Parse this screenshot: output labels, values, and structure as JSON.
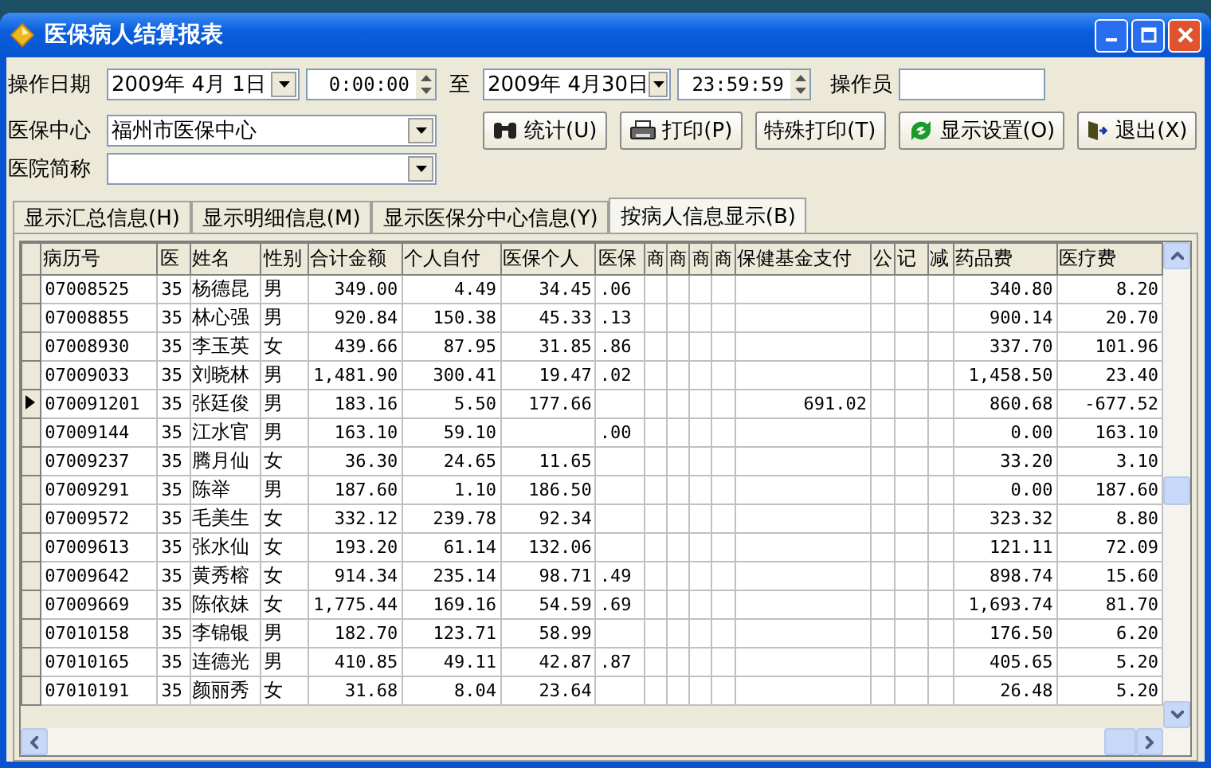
{
  "window": {
    "title": "医保病人结算报表"
  },
  "filters": {
    "date_label": "操作日期",
    "start_date": "2009年 4月 1日",
    "start_time": "0:00:00",
    "to_label": "至",
    "end_date": "2009年 4月30日",
    "end_time": "23:59:59",
    "operator_label": "操作员",
    "center_label": "医保中心",
    "center_value": "福州市医保中心",
    "hospital_label": "医院简称"
  },
  "buttons": [
    {
      "label": "统计(U)",
      "kind": "binoculars"
    },
    {
      "label": "打印(P)",
      "kind": "printer"
    },
    {
      "label": "特殊打印(T)",
      "kind": "plain"
    },
    {
      "label": "显示设置(O)",
      "kind": "refresh"
    },
    {
      "label": "退出(X)",
      "kind": "exit"
    }
  ],
  "tabs": [
    {
      "label": "显示汇总信息(H)",
      "selected": false
    },
    {
      "label": "显示明细信息(M)",
      "selected": false
    },
    {
      "label": "显示医保分中心信息(Y)",
      "selected": false
    },
    {
      "label": "按病人信息显示(B)",
      "selected": true
    }
  ],
  "table": {
    "columns": [
      "病历号",
      "医",
      "姓名",
      "性别",
      "合计金额",
      "个人自付",
      "医保个人",
      "医保",
      "商",
      "商",
      "商",
      "商",
      "保健基金支付",
      "公",
      "记",
      "减",
      "药品费",
      "医疗费"
    ],
    "rows": [
      {
        "selected": false,
        "cells": [
          "07008525",
          "35",
          "杨德昆",
          "男",
          "349.00",
          "4.49",
          "34.45",
          ".06",
          null,
          null,
          null,
          null,
          null,
          null,
          null,
          null,
          "340.80",
          "8.20"
        ]
      },
      {
        "selected": false,
        "cells": [
          "07008855",
          "35",
          "林心强",
          "男",
          "920.84",
          "150.38",
          "45.33",
          ".13",
          null,
          null,
          null,
          null,
          null,
          null,
          null,
          null,
          "900.14",
          "20.70"
        ]
      },
      {
        "selected": false,
        "cells": [
          "07008930",
          "35",
          "李玉英",
          "女",
          "439.66",
          "87.95",
          "31.85",
          ".86",
          null,
          null,
          null,
          null,
          null,
          null,
          null,
          null,
          "337.70",
          "101.96"
        ]
      },
      {
        "selected": false,
        "cells": [
          "07009033",
          "35",
          "刘晓林",
          "男",
          "1,481.90",
          "300.41",
          "19.47",
          ".02",
          null,
          null,
          null,
          null,
          null,
          null,
          null,
          null,
          "1,458.50",
          "23.40"
        ]
      },
      {
        "selected": true,
        "cells": [
          "070091201",
          "35",
          "张廷俊",
          "男",
          "183.16",
          "5.50",
          "177.66",
          null,
          null,
          null,
          null,
          null,
          "691.02",
          null,
          null,
          null,
          "860.68",
          "-677.52"
        ]
      },
      {
        "selected": false,
        "cells": [
          "07009144",
          "35",
          "江水官",
          "男",
          "163.10",
          "59.10",
          null,
          ".00",
          null,
          null,
          null,
          null,
          null,
          null,
          null,
          null,
          "0.00",
          "163.10"
        ]
      },
      {
        "selected": false,
        "cells": [
          "07009237",
          "35",
          "腾月仙",
          "女",
          "36.30",
          "24.65",
          "11.65",
          null,
          null,
          null,
          null,
          null,
          null,
          null,
          null,
          null,
          "33.20",
          "3.10"
        ]
      },
      {
        "selected": false,
        "cells": [
          "07009291",
          "35",
          "陈举",
          "男",
          "187.60",
          "1.10",
          "186.50",
          null,
          null,
          null,
          null,
          null,
          null,
          null,
          null,
          null,
          "0.00",
          "187.60"
        ]
      },
      {
        "selected": false,
        "cells": [
          "07009572",
          "35",
          "毛美生",
          "女",
          "332.12",
          "239.78",
          "92.34",
          null,
          null,
          null,
          null,
          null,
          null,
          null,
          null,
          null,
          "323.32",
          "8.80"
        ]
      },
      {
        "selected": false,
        "cells": [
          "07009613",
          "35",
          "张水仙",
          "女",
          "193.20",
          "61.14",
          "132.06",
          null,
          null,
          null,
          null,
          null,
          null,
          null,
          null,
          null,
          "121.11",
          "72.09"
        ]
      },
      {
        "selected": false,
        "cells": [
          "07009642",
          "35",
          "黄秀榕",
          "女",
          "914.34",
          "235.14",
          "98.71",
          ".49",
          null,
          null,
          null,
          null,
          null,
          null,
          null,
          null,
          "898.74",
          "15.60"
        ]
      },
      {
        "selected": false,
        "cells": [
          "07009669",
          "35",
          "陈依妹",
          "女",
          "1,775.44",
          "169.16",
          "54.59",
          ".69",
          null,
          null,
          null,
          null,
          null,
          null,
          null,
          null,
          "1,693.74",
          "81.70"
        ]
      },
      {
        "selected": false,
        "cells": [
          "07010158",
          "35",
          "李锦银",
          "男",
          "182.70",
          "123.71",
          "58.99",
          null,
          null,
          null,
          null,
          null,
          null,
          null,
          null,
          null,
          "176.50",
          "6.20"
        ]
      },
      {
        "selected": false,
        "cells": [
          "07010165",
          "35",
          "连德光",
          "男",
          "410.85",
          "49.11",
          "42.87",
          ".87",
          null,
          null,
          null,
          null,
          null,
          null,
          null,
          null,
          "405.65",
          "5.20"
        ]
      },
      {
        "selected": false,
        "cells": [
          "07010191",
          "35",
          "颜丽秀",
          "女",
          "31.68",
          "8.04",
          "23.64",
          null,
          null,
          null,
          null,
          null,
          null,
          null,
          null,
          null,
          "26.48",
          "5.20"
        ]
      }
    ]
  }
}
